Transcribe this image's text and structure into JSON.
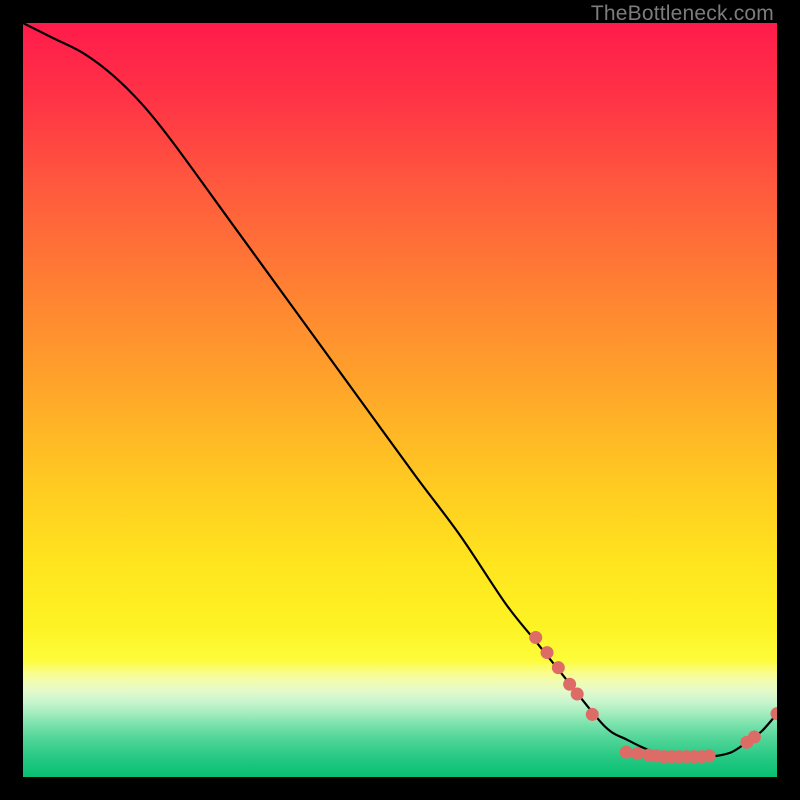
{
  "watermark": "TheBottleneck.com",
  "colors": {
    "curve": "#000000",
    "marker_fill": "#dd6b66",
    "marker_stroke": "#b84f4b"
  },
  "chart_data": {
    "type": "line",
    "title": "",
    "xlabel": "",
    "ylabel": "",
    "xlim": [
      0,
      100
    ],
    "ylim": [
      0,
      100
    ],
    "grid": false,
    "series": [
      {
        "name": "curve",
        "x": [
          0,
          4,
          8,
          12,
          16,
          20,
          28,
          36,
          44,
          52,
          58,
          64,
          68,
          72,
          76,
          78,
          80,
          82,
          84,
          86,
          88,
          90,
          92,
          94,
          96,
          98,
          100
        ],
        "y": [
          100,
          98,
          96,
          93,
          89,
          84,
          73,
          62,
          51,
          40,
          32,
          23,
          18,
          13,
          8,
          6,
          5,
          4,
          3.2,
          2.8,
          2.7,
          2.7,
          2.8,
          3.3,
          4.6,
          6.1,
          8.4
        ]
      }
    ],
    "markers": [
      {
        "x": 68.0,
        "y": 18.5
      },
      {
        "x": 69.5,
        "y": 16.5
      },
      {
        "x": 71.0,
        "y": 14.5
      },
      {
        "x": 72.5,
        "y": 12.3
      },
      {
        "x": 73.5,
        "y": 11.0
      },
      {
        "x": 75.5,
        "y": 8.3
      },
      {
        "x": 80.0,
        "y": 3.3
      },
      {
        "x": 81.5,
        "y": 3.1
      },
      {
        "x": 83.0,
        "y": 2.9
      },
      {
        "x": 84.0,
        "y": 2.8
      },
      {
        "x": 85.0,
        "y": 2.7
      },
      {
        "x": 86.0,
        "y": 2.7
      },
      {
        "x": 87.0,
        "y": 2.7
      },
      {
        "x": 88.0,
        "y": 2.7
      },
      {
        "x": 89.0,
        "y": 2.7
      },
      {
        "x": 90.0,
        "y": 2.7
      },
      {
        "x": 91.0,
        "y": 2.8
      },
      {
        "x": 96.0,
        "y": 4.6
      },
      {
        "x": 97.0,
        "y": 5.3
      },
      {
        "x": 100.0,
        "y": 8.4
      }
    ],
    "gradient_stops": [
      {
        "offset": 0.0,
        "color": "#ff1b4b"
      },
      {
        "offset": 0.1,
        "color": "#ff3346"
      },
      {
        "offset": 0.22,
        "color": "#ff5a3d"
      },
      {
        "offset": 0.35,
        "color": "#ff8033"
      },
      {
        "offset": 0.48,
        "color": "#ffa42a"
      },
      {
        "offset": 0.6,
        "color": "#ffc722"
      },
      {
        "offset": 0.72,
        "color": "#ffe51e"
      },
      {
        "offset": 0.8,
        "color": "#fdf324"
      },
      {
        "offset": 0.845,
        "color": "#fdfc3a"
      },
      {
        "offset": 0.855,
        "color": "#fbfd6b"
      },
      {
        "offset": 0.863,
        "color": "#f8fd8e"
      },
      {
        "offset": 0.873,
        "color": "#f2fcb0"
      },
      {
        "offset": 0.886,
        "color": "#e3facb"
      },
      {
        "offset": 0.9,
        "color": "#c9f5cd"
      },
      {
        "offset": 0.915,
        "color": "#a4edbe"
      },
      {
        "offset": 0.93,
        "color": "#7be2ac"
      },
      {
        "offset": 0.95,
        "color": "#4fd597"
      },
      {
        "offset": 0.975,
        "color": "#25c882"
      },
      {
        "offset": 1.0,
        "color": "#08bf72"
      }
    ]
  }
}
